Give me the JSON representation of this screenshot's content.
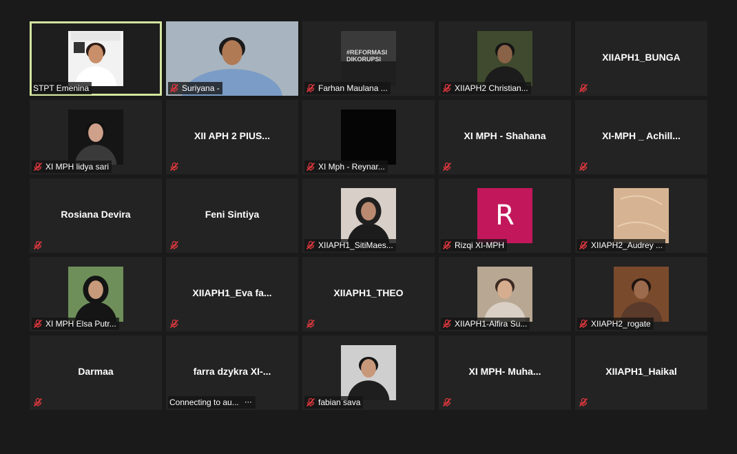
{
  "colors": {
    "background": "#1a1a1a",
    "tile": "#232323",
    "active_border": "#d4e6a0",
    "muted_icon": "#e0383e",
    "avatar_letter_bg": "#c2185b"
  },
  "participants": [
    {
      "label": "STPT Emenina",
      "muted": false,
      "active": true,
      "kind": "photo",
      "theme": "emenina"
    },
    {
      "label": "Suriyana -",
      "muted": true,
      "kind": "video",
      "theme": "suriyana"
    },
    {
      "label": "Farhan Maulana ...",
      "muted": true,
      "kind": "photo",
      "theme": "farhan",
      "photo_text": "#REFORMASI DIKORUPSI"
    },
    {
      "label": "XIIAPH2 Christian...",
      "muted": true,
      "kind": "photo",
      "theme": "christian"
    },
    {
      "label": "",
      "muted": true,
      "kind": "name",
      "display_name": "XIIAPH1_BUNGA"
    },
    {
      "label": "XI MPH lidya sari",
      "muted": true,
      "kind": "photo",
      "theme": "lidya"
    },
    {
      "label": "",
      "muted": true,
      "kind": "name",
      "display_name": "XII APH 2 PIUS..."
    },
    {
      "label": "XI Mph - Reynar...",
      "muted": true,
      "kind": "photo",
      "theme": "reynar"
    },
    {
      "label": "",
      "muted": true,
      "kind": "name",
      "display_name": "XI MPH - Shahana"
    },
    {
      "label": "",
      "muted": true,
      "kind": "name",
      "display_name": "XI-MPH _ Achill..."
    },
    {
      "label": "",
      "muted": true,
      "kind": "name",
      "display_name": "Rosiana Devira"
    },
    {
      "label": "",
      "muted": true,
      "kind": "name",
      "display_name": "Feni Sintiya"
    },
    {
      "label": "XIIAPH1_SitiMaes...",
      "muted": true,
      "kind": "photo",
      "theme": "siti"
    },
    {
      "label": "Rizqi XI-MPH",
      "muted": true,
      "kind": "letter",
      "letter": "R"
    },
    {
      "label": "XIIAPH2_Audrey ...",
      "muted": true,
      "kind": "photo",
      "theme": "audrey"
    },
    {
      "label": "XI MPH Elsa Putr...",
      "muted": true,
      "kind": "photo",
      "theme": "elsa"
    },
    {
      "label": "",
      "muted": true,
      "kind": "name",
      "display_name": "XIIAPH1_Eva fa..."
    },
    {
      "label": "",
      "muted": true,
      "kind": "name",
      "display_name": "XIIAPH1_THEO"
    },
    {
      "label": "XIIAPH1-Alfira Su...",
      "muted": true,
      "kind": "photo",
      "theme": "alfira"
    },
    {
      "label": "XIIAPH2_rogate",
      "muted": true,
      "kind": "photo",
      "theme": "rogate"
    },
    {
      "label": "",
      "muted": true,
      "kind": "name",
      "display_name": "Darmaa"
    },
    {
      "label": "Connecting to au...",
      "muted": false,
      "connecting": true,
      "kind": "name",
      "display_name": "farra dzykra XI-..."
    },
    {
      "label": "fabian sava",
      "muted": true,
      "kind": "photo",
      "theme": "fabian"
    },
    {
      "label": "",
      "muted": true,
      "kind": "name",
      "display_name": "XI MPH-  Muha..."
    },
    {
      "label": "",
      "muted": true,
      "kind": "name",
      "display_name": "XIIAPH1_Haikal"
    }
  ]
}
